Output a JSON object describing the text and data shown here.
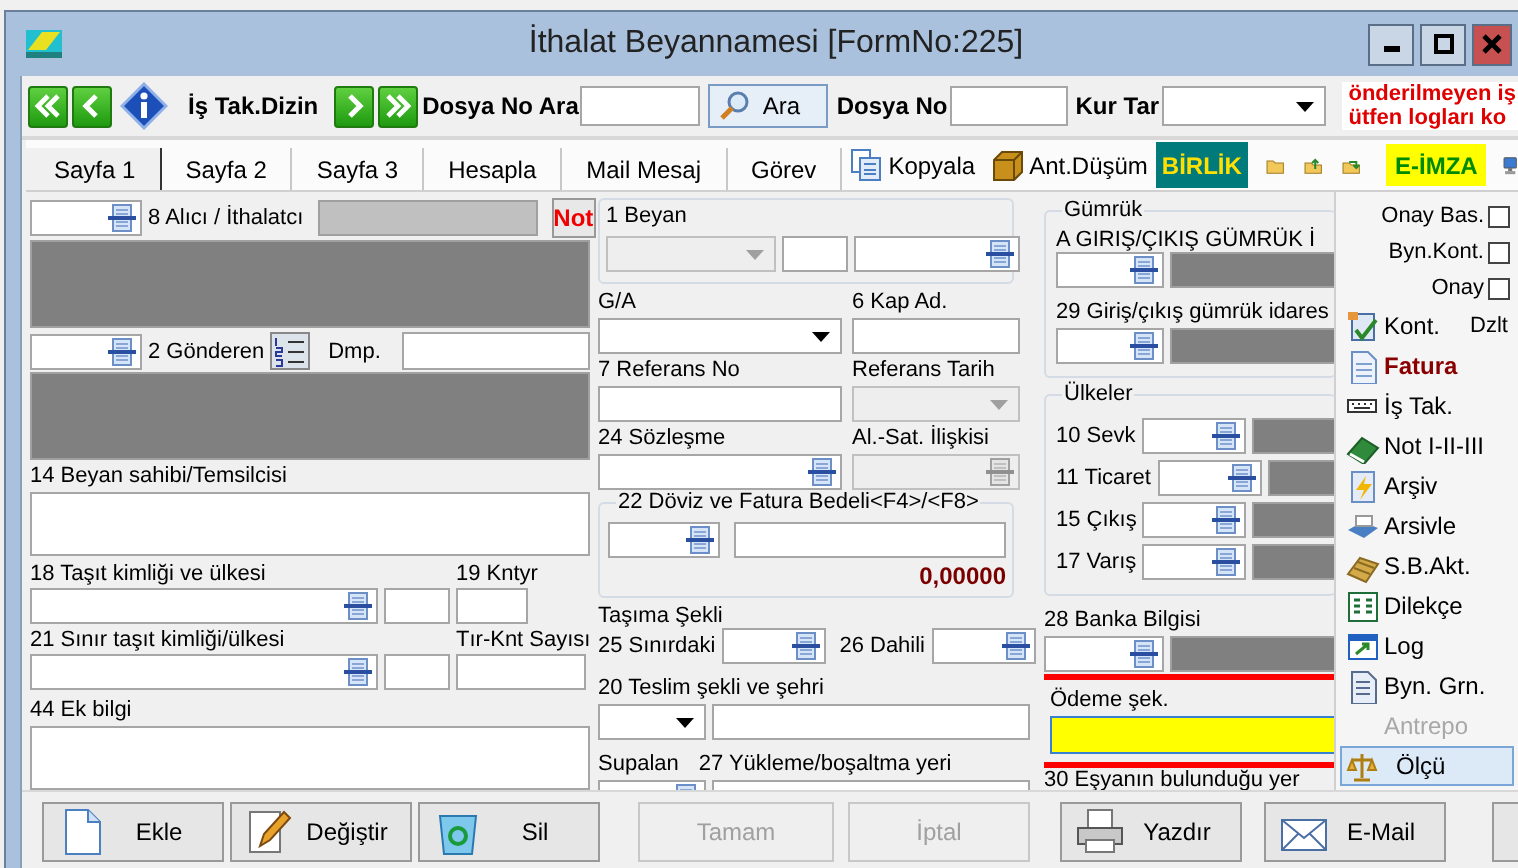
{
  "window": {
    "title": "İthalat Beyannamesi [FormNo:225]"
  },
  "toolbar": {
    "is_tak_dizin": "İş Tak.Dizin",
    "dosya_no_ara": "Dosya No Ara",
    "ara_button": "Ara",
    "dosya_no": "Dosya No",
    "kur_tar": "Kur Tar",
    "warning_lines": [
      "önderilmeyen iş",
      "ütfen logları ko"
    ]
  },
  "tabs": [
    {
      "label": "Sayfa 1",
      "selected": true
    },
    {
      "label": "Sayfa 2",
      "selected": false
    },
    {
      "label": "Sayfa 3",
      "selected": false
    },
    {
      "label": "Hesapla",
      "selected": false
    },
    {
      "label": "Mail Mesaj",
      "selected": false
    },
    {
      "label": "Görev",
      "selected": false
    }
  ],
  "tab_tools": {
    "kopyala": "Kopyala",
    "ant_dusum": "Ant.Düşüm",
    "birlik": "BİRLİK",
    "e_imza": "E-İMZA"
  },
  "left": {
    "alici": "8 Alıcı / İthalatcı",
    "not_button": "Not",
    "gonderen": "2 Gönderen",
    "dmp": "Dmp.",
    "beyan_sahibi": "14 Beyan sahibi/Temsilcisi",
    "tasit": "18 Taşıt kimliği ve ülkesi",
    "kntyr": "19 Kntyr",
    "sinir_tasit": "21 Sınır taşıt kimliği/ülkesi",
    "tir_knt": "Tır-Knt Sayısı",
    "ek_bilgi": "44 Ek bilgi"
  },
  "middle": {
    "beyan": "1 Beyan",
    "ga": "G/A",
    "kap_ad": "6 Kap Ad.",
    "referans_no": "7 Referans No",
    "referans_tarih": "Referans Tarih",
    "sozlesme": "24 Sözleşme",
    "al_sat": "Al.-Sat. İlişkisi",
    "doviz": "22 Döviz ve Fatura Bedeli<F4>/<F8>",
    "doviz_total": "0,00000",
    "tasima": "Taşıma Şekli",
    "sinirdaki": "25 Sınırdaki",
    "dahili": "26 Dahili",
    "teslim": "20 Teslim şekli ve şehri",
    "supalan": "Supalan",
    "yukleme": "27 Yükleme/boşaltma yeri"
  },
  "right": {
    "gumruk": "Gümrük",
    "giris_cikis": "A GIRIŞ/ÇIKIŞ GÜMRÜK İ",
    "giris_idare": "29 Giriş/çıkış gümrük idares",
    "ulkeler": "Ülkeler",
    "countries": [
      "10 Sevk",
      "11 Ticaret",
      "15 Çıkış",
      "17 Varış"
    ],
    "banka": "28 Banka Bilgisi",
    "odeme": {
      "label": "Ödeme şek.",
      "focused": true,
      "highlighted": true
    },
    "esya": "30 Eşyanın bulunduğu yer"
  },
  "sidebar": {
    "checks": [
      {
        "label": "Onay Bas.",
        "checked": false
      },
      {
        "label": "Byn.Kont.",
        "checked": false
      },
      {
        "label": "Onay",
        "checked": false
      }
    ],
    "items": [
      {
        "label": "Kont.",
        "extra": "Dzlt",
        "emphasized": false,
        "disabled": false,
        "selected": false
      },
      {
        "label": "Fatura",
        "emphasized": true,
        "disabled": false,
        "selected": false
      },
      {
        "label": "İş Tak.",
        "emphasized": false,
        "disabled": false,
        "selected": false
      },
      {
        "label": "Not I-II-III",
        "emphasized": false,
        "disabled": false,
        "selected": false
      },
      {
        "label": "Arşiv",
        "emphasized": false,
        "disabled": false,
        "selected": false
      },
      {
        "label": "Arsivle",
        "emphasized": false,
        "disabled": false,
        "selected": false
      },
      {
        "label": "S.B.Akt.",
        "emphasized": false,
        "disabled": false,
        "selected": false
      },
      {
        "label": "Dilekçe",
        "emphasized": false,
        "disabled": false,
        "selected": false
      },
      {
        "label": "Log",
        "emphasized": false,
        "disabled": false,
        "selected": false
      },
      {
        "label": "Byn. Grn.",
        "emphasized": false,
        "disabled": false,
        "selected": false
      },
      {
        "label": "Antrepo",
        "emphasized": false,
        "disabled": true,
        "selected": false
      },
      {
        "label": "Ölçü",
        "emphasized": false,
        "disabled": false,
        "selected": true
      }
    ]
  },
  "buttons": [
    {
      "label": "Ekle",
      "disabled": false
    },
    {
      "label": "Değiştir",
      "disabled": false
    },
    {
      "label": "Sil",
      "disabled": false
    },
    {
      "label": "Tamam",
      "disabled": true
    },
    {
      "label": "İptal",
      "disabled": true
    },
    {
      "label": "Yazdır",
      "disabled": false
    },
    {
      "label": "E-Mail",
      "disabled": false
    }
  ]
}
